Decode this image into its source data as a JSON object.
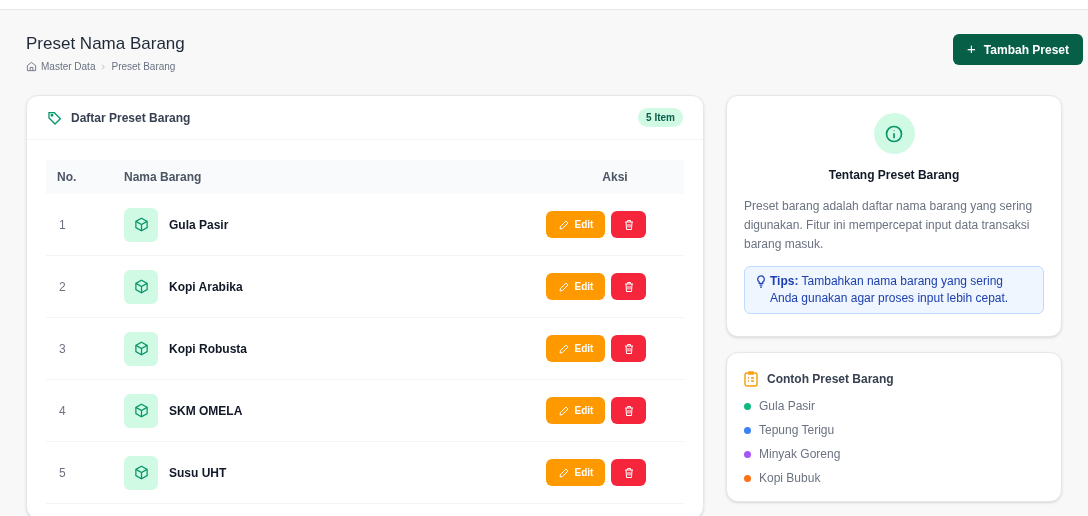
{
  "header": {
    "title": "Preset Nama Barang",
    "breadcrumb": [
      "Master Data",
      "Preset Barang"
    ],
    "add_button": "Tambah Preset",
    "add_icon": "+"
  },
  "list_card": {
    "title": "Daftar Preset Barang",
    "count_badge": "5 Item",
    "columns": [
      "No.",
      "Nama Barang",
      "Aksi"
    ],
    "rows": [
      {
        "no": "1",
        "name": "Gula Pasir",
        "edit": "Edit"
      },
      {
        "no": "2",
        "name": "Kopi Arabika",
        "edit": "Edit"
      },
      {
        "no": "3",
        "name": "Kopi Robusta",
        "edit": "Edit"
      },
      {
        "no": "4",
        "name": "SKM OMELA",
        "edit": "Edit"
      },
      {
        "no": "5",
        "name": "Susu UHT",
        "edit": "Edit"
      }
    ]
  },
  "info_card": {
    "title": "Tentang Preset Barang",
    "text": "Preset barang adalah daftar nama barang yang sering digunakan. Fitur ini mempercepat input data transaksi barang masuk.",
    "tips": "**Tips:** Tambahkan nama barang yang sering Anda gunakan agar proses input lebih cepat."
  },
  "examples_card": {
    "title": "Contoh Preset Barang",
    "items": [
      {
        "label": "Gula Pasir",
        "color": "#10b981"
      },
      {
        "label": "Tepung Terigu",
        "color": "#3b82f6"
      },
      {
        "label": "Minyak Goreng",
        "color": "#a855f7"
      },
      {
        "label": "Kopi Bubuk",
        "color": "#f97316"
      }
    ]
  }
}
